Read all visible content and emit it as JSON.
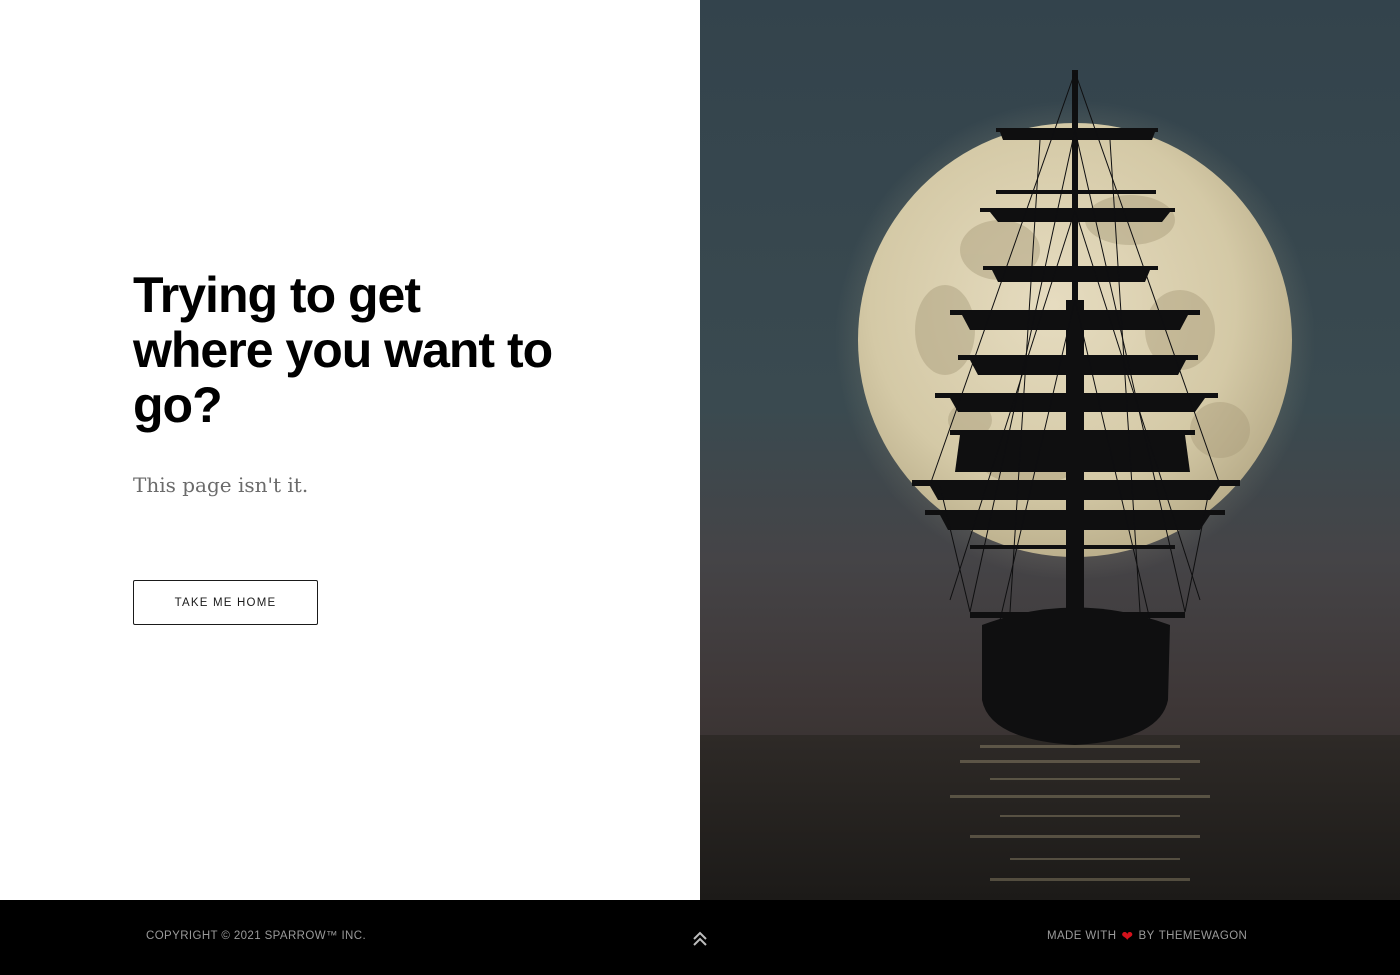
{
  "hero": {
    "heading": "Trying to get where you want to go?",
    "subtext": "This page isn't it.",
    "home_button_label": "TAKE ME HOME"
  },
  "image": {
    "subject": "ship-silhouette-full-moon",
    "colors": {
      "sky_top": "#33434c",
      "sky_bottom": "#3a3d3f",
      "moon": "#d9cfb0",
      "ship": "#0f0f10",
      "sea": "#26231f"
    }
  },
  "footer": {
    "copyright": "COPYRIGHT © 2021 SPARROW™ INC.",
    "made_with_prefix": "MADE WITH",
    "made_with_by": "BY",
    "made_with_brand": "THEMEWAGON",
    "back_to_top_icon": "double-chevron-up-icon",
    "heart_icon": "heart-icon",
    "heart_color": "#d4111b"
  }
}
